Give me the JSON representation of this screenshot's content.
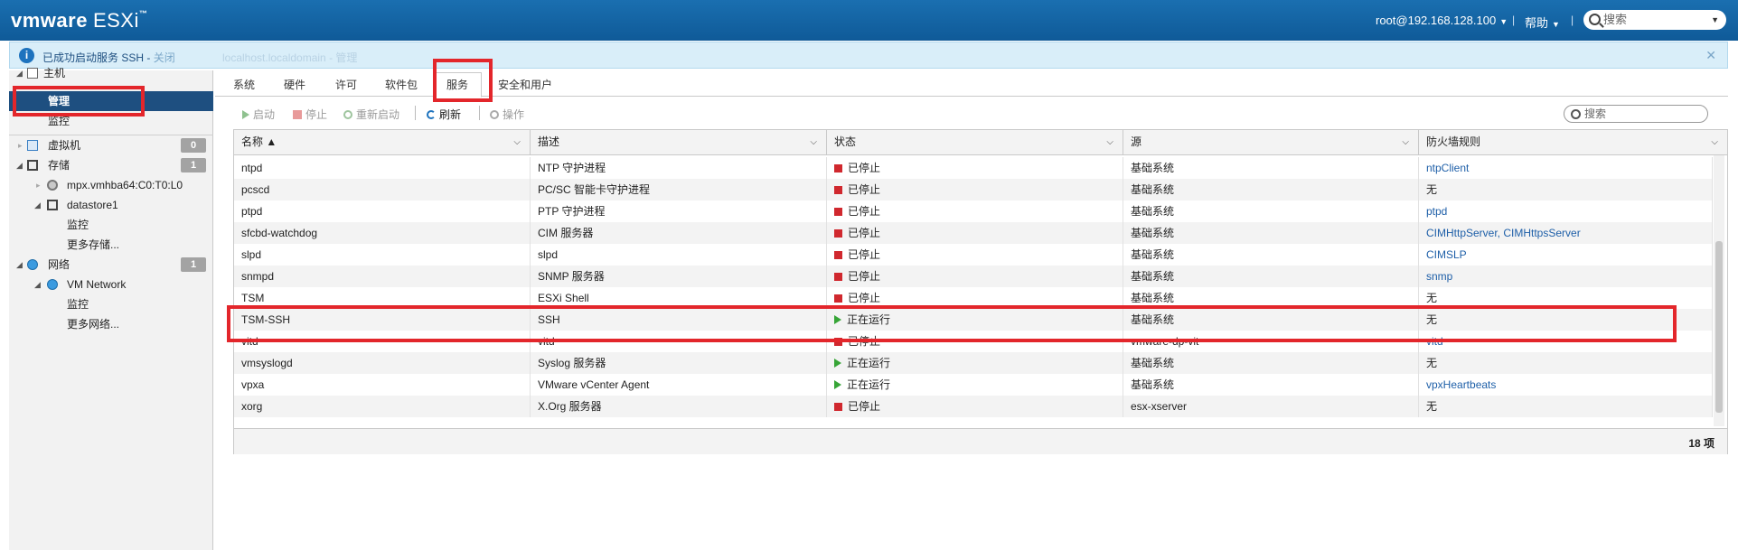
{
  "header": {
    "logo_brand": "vmware",
    "logo_product": "ESXi",
    "logo_tm": "™",
    "user": "root@192.168.128.100",
    "separator": "|",
    "help": "帮助",
    "search_placeholder": "搜索"
  },
  "notice": {
    "message": "已成功启动服务 SSH - ",
    "close_link": "关闭",
    "background_text": "localhost.localdomain - 管理"
  },
  "nav": {
    "host": "主机",
    "manage": "管理",
    "monitor": "监控",
    "vms": "虚拟机",
    "vms_count": "0",
    "storage": "存储",
    "storage_count": "1",
    "storage_device": "mpx.vmhba64:C0:T0:L0",
    "datastore": "datastore1",
    "datastore_monitor": "监控",
    "more_storage": "更多存储...",
    "network": "网络",
    "network_count": "1",
    "vm_network": "VM Network",
    "network_monitor": "监控",
    "more_network": "更多网络..."
  },
  "tabs": [
    "系统",
    "硬件",
    "许可",
    "软件包",
    "服务",
    "安全和用户"
  ],
  "toolbar": {
    "start": "启动",
    "stop": "停止",
    "restart": "重新启动",
    "refresh": "刷新",
    "actions": "操作",
    "search_placeholder": "搜索"
  },
  "grid": {
    "columns": [
      "名称 ▲",
      "描述",
      "状态",
      "源",
      "防火墙规则"
    ],
    "rows": [
      {
        "name": "ntpd",
        "desc": "NTP 守护进程",
        "status": "已停止",
        "running": false,
        "source": "基础系统",
        "fw": "ntpClient",
        "fw_link": true
      },
      {
        "name": "pcscd",
        "desc": "PC/SC 智能卡守护进程",
        "status": "已停止",
        "running": false,
        "source": "基础系统",
        "fw": "无",
        "fw_link": false
      },
      {
        "name": "ptpd",
        "desc": "PTP 守护进程",
        "status": "已停止",
        "running": false,
        "source": "基础系统",
        "fw": "ptpd",
        "fw_link": true
      },
      {
        "name": "sfcbd-watchdog",
        "desc": "CIM 服务器",
        "status": "已停止",
        "running": false,
        "source": "基础系统",
        "fw": "CIMHttpServer, CIMHttpsServer",
        "fw_link": true
      },
      {
        "name": "slpd",
        "desc": "slpd",
        "status": "已停止",
        "running": false,
        "source": "基础系统",
        "fw": "CIMSLP",
        "fw_link": true
      },
      {
        "name": "snmpd",
        "desc": "SNMP 服务器",
        "status": "已停止",
        "running": false,
        "source": "基础系统",
        "fw": "snmp",
        "fw_link": true
      },
      {
        "name": "TSM",
        "desc": "ESXi Shell",
        "status": "已停止",
        "running": false,
        "source": "基础系统",
        "fw": "无",
        "fw_link": false
      },
      {
        "name": "TSM-SSH",
        "desc": "SSH",
        "status": "正在运行",
        "running": true,
        "source": "基础系统",
        "fw": "无",
        "fw_link": false
      },
      {
        "name": "vitd",
        "desc": "vitd",
        "status": "已停止",
        "running": false,
        "source": "vmware-dp-vit",
        "fw": "vitd",
        "fw_link": true
      },
      {
        "name": "vmsyslogd",
        "desc": "Syslog 服务器",
        "status": "正在运行",
        "running": true,
        "source": "基础系统",
        "fw": "无",
        "fw_link": false
      },
      {
        "name": "vpxa",
        "desc": "VMware vCenter Agent",
        "status": "正在运行",
        "running": true,
        "source": "基础系统",
        "fw": "vpxHeartbeats",
        "fw_link": true
      },
      {
        "name": "xorg",
        "desc": "X.Org 服务器",
        "status": "已停止",
        "running": false,
        "source": "esx-xserver",
        "fw": "无",
        "fw_link": false
      }
    ],
    "count": "18 项"
  }
}
